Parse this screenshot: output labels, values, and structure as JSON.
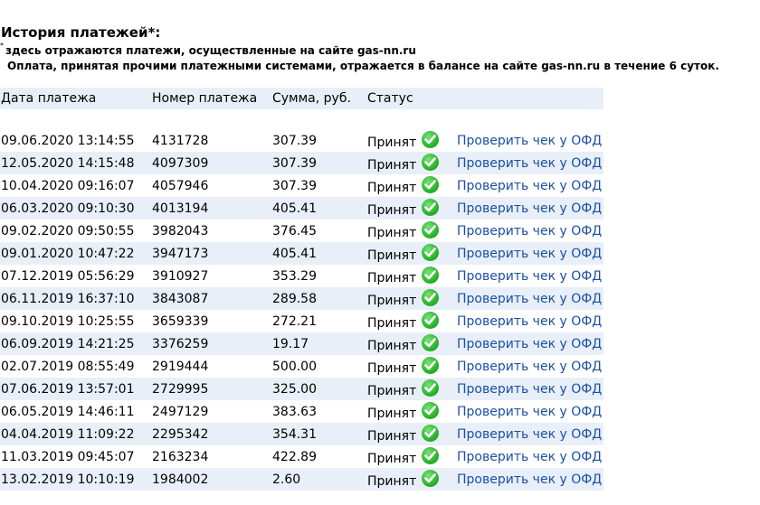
{
  "header": {
    "title": "История платежей*:",
    "note_mark": "*",
    "note_line1": "здесь отражаются платежи, осуществленные на сайте gas-nn.ru",
    "note_line2": "Оплата, принятая прочими платежными системами, отражается в балансе на сайте gas-nn.ru в течение 6 суток."
  },
  "table": {
    "columns": [
      "Дата платежа",
      "Номер платежа",
      "Сумма, руб.",
      "Статус"
    ],
    "link_label": "Проверить чек у ОФД",
    "icons": {
      "status": "check-circle-icon",
      "status_color": "#2eb82e"
    },
    "rows": [
      {
        "date": "09.06.2020 13:14:55",
        "number": "4131728",
        "sum": "307.39",
        "status": "Принят"
      },
      {
        "date": "12.05.2020 14:15:48",
        "number": "4097309",
        "sum": "307.39",
        "status": "Принят"
      },
      {
        "date": "10.04.2020 09:16:07",
        "number": "4057946",
        "sum": "307.39",
        "status": "Принят"
      },
      {
        "date": "06.03.2020 09:10:30",
        "number": "4013194",
        "sum": "405.41",
        "status": "Принят"
      },
      {
        "date": "09.02.2020 09:50:55",
        "number": "3982043",
        "sum": "376.45",
        "status": "Принят"
      },
      {
        "date": "09.01.2020 10:47:22",
        "number": "3947173",
        "sum": "405.41",
        "status": "Принят"
      },
      {
        "date": "07.12.2019 05:56:29",
        "number": "3910927",
        "sum": "353.29",
        "status": "Принят"
      },
      {
        "date": "06.11.2019 16:37:10",
        "number": "3843087",
        "sum": "289.58",
        "status": "Принят"
      },
      {
        "date": "09.10.2019 10:25:55",
        "number": "3659339",
        "sum": "272.21",
        "status": "Принят"
      },
      {
        "date": "06.09.2019 14:21:25",
        "number": "3376259",
        "sum": "19.17",
        "status": "Принят"
      },
      {
        "date": "02.07.2019 08:55:49",
        "number": "2919444",
        "sum": "500.00",
        "status": "Принят"
      },
      {
        "date": "07.06.2019 13:57:01",
        "number": "2729995",
        "sum": "325.00",
        "status": "Принят"
      },
      {
        "date": "06.05.2019 14:46:11",
        "number": "2497129",
        "sum": "383.63",
        "status": "Принят"
      },
      {
        "date": "04.04.2019 11:09:22",
        "number": "2295342",
        "sum": "354.31",
        "status": "Принят"
      },
      {
        "date": "11.03.2019 09:45:07",
        "number": "2163234",
        "sum": "422.89",
        "status": "Принят"
      },
      {
        "date": "13.02.2019 10:10:19",
        "number": "1984002",
        "sum": "2.60",
        "status": "Принят"
      }
    ]
  }
}
